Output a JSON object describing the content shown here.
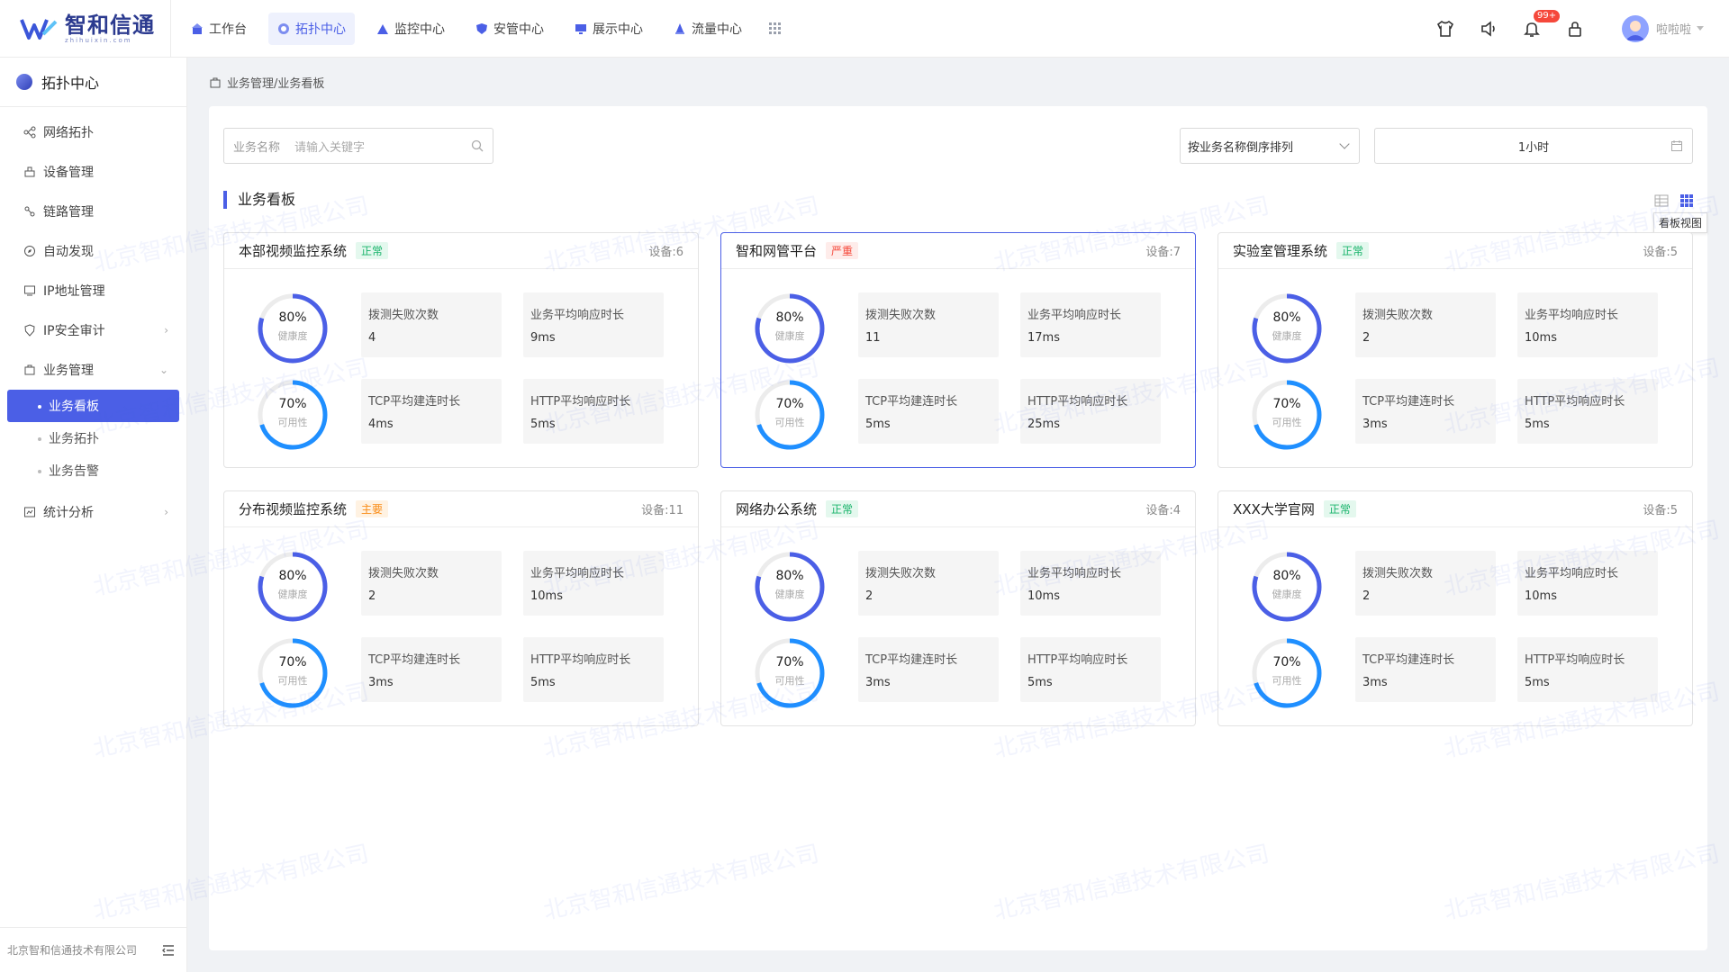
{
  "brand": {
    "title": "智和信通",
    "subtitle": "zhihuixin.com"
  },
  "nav": [
    {
      "label": "工作台",
      "icon": "home-icon",
      "active": false
    },
    {
      "label": "拓扑中心",
      "icon": "topology-icon",
      "active": true
    },
    {
      "label": "监控中心",
      "icon": "monitor-icon",
      "active": false
    },
    {
      "label": "安管中心",
      "icon": "shield-icon",
      "active": false
    },
    {
      "label": "展示中心",
      "icon": "display-icon",
      "active": false
    },
    {
      "label": "流量中心",
      "icon": "traffic-icon",
      "active": false
    }
  ],
  "header": {
    "badge": "99+",
    "username": "啦啦啦"
  },
  "sidebar": {
    "title": "拓扑中心",
    "items": [
      {
        "label": "网络拓扑",
        "icon": "network-icon"
      },
      {
        "label": "设备管理",
        "icon": "device-icon"
      },
      {
        "label": "链路管理",
        "icon": "link-icon"
      },
      {
        "label": "自动发现",
        "icon": "discover-icon"
      },
      {
        "label": "IP地址管理",
        "icon": "ip-icon"
      },
      {
        "label": "IP安全审计",
        "icon": "audit-icon"
      },
      {
        "label": "业务管理",
        "icon": "business-icon"
      }
    ],
    "sub_items": [
      {
        "label": "业务看板",
        "active": true
      },
      {
        "label": "业务拓扑",
        "active": false
      },
      {
        "label": "业务告警",
        "active": false
      }
    ],
    "extra": {
      "label": "统计分析",
      "icon": "stats-icon"
    },
    "footer": "北京智和信通技术有限公司"
  },
  "breadcrumb": "业务管理/业务看板",
  "filters": {
    "search_label": "业务名称",
    "search_placeholder": "请输入关键字",
    "sort_value": "按业务名称倒序排列",
    "time_value": "1小时"
  },
  "section_title": "业务看板",
  "view_tooltip": "看板视图",
  "watermark": "北京智和信通技术有限公司",
  "colors": {
    "accent": "#4b5fe6",
    "gauge_health": "#4b5fe6",
    "gauge_avail": "#1f8fff"
  },
  "cards": [
    {
      "name": "本部视频监控系统",
      "status": "正常",
      "status_type": "normal",
      "device": "设备:6",
      "selected": false,
      "health": 0.8,
      "health_text": "80%",
      "health_label": "健康度",
      "avail": 0.7,
      "avail_text": "70%",
      "avail_label": "可用性",
      "metrics": [
        {
          "label": "拨测失败次数",
          "value": "4"
        },
        {
          "label": "业务平均响应时长",
          "value": "9ms"
        },
        {
          "label": "TCP平均建连时长",
          "value": "4ms"
        },
        {
          "label": "HTTP平均响应时长",
          "value": "5ms"
        }
      ]
    },
    {
      "name": "智和网管平台",
      "status": "严重",
      "status_type": "severe",
      "device": "设备:7",
      "selected": true,
      "health": 0.8,
      "health_text": "80%",
      "health_label": "健康度",
      "avail": 0.7,
      "avail_text": "70%",
      "avail_label": "可用性",
      "metrics": [
        {
          "label": "拨测失败次数",
          "value": "11"
        },
        {
          "label": "业务平均响应时长",
          "value": "17ms"
        },
        {
          "label": "TCP平均建连时长",
          "value": "5ms"
        },
        {
          "label": "HTTP平均响应时长",
          "value": "25ms"
        }
      ]
    },
    {
      "name": "实验室管理系统",
      "status": "正常",
      "status_type": "normal",
      "device": "设备:5",
      "selected": false,
      "health": 0.8,
      "health_text": "80%",
      "health_label": "健康度",
      "avail": 0.7,
      "avail_text": "70%",
      "avail_label": "可用性",
      "metrics": [
        {
          "label": "拨测失败次数",
          "value": "2"
        },
        {
          "label": "业务平均响应时长",
          "value": "10ms"
        },
        {
          "label": "TCP平均建连时长",
          "value": "3ms"
        },
        {
          "label": "HTTP平均响应时长",
          "value": "5ms"
        }
      ]
    },
    {
      "name": "分布视频监控系统",
      "status": "主要",
      "status_type": "major",
      "device": "设备:11",
      "selected": false,
      "health": 0.8,
      "health_text": "80%",
      "health_label": "健康度",
      "avail": 0.7,
      "avail_text": "70%",
      "avail_label": "可用性",
      "metrics": [
        {
          "label": "拨测失败次数",
          "value": "2"
        },
        {
          "label": "业务平均响应时长",
          "value": "10ms"
        },
        {
          "label": "TCP平均建连时长",
          "value": "3ms"
        },
        {
          "label": "HTTP平均响应时长",
          "value": "5ms"
        }
      ]
    },
    {
      "name": "网络办公系统",
      "status": "正常",
      "status_type": "normal",
      "device": "设备:4",
      "selected": false,
      "health": 0.8,
      "health_text": "80%",
      "health_label": "健康度",
      "avail": 0.7,
      "avail_text": "70%",
      "avail_label": "可用性",
      "metrics": [
        {
          "label": "拨测失败次数",
          "value": "2"
        },
        {
          "label": "业务平均响应时长",
          "value": "10ms"
        },
        {
          "label": "TCP平均建连时长",
          "value": "3ms"
        },
        {
          "label": "HTTP平均响应时长",
          "value": "5ms"
        }
      ]
    },
    {
      "name": "XXX大学官网",
      "status": "正常",
      "status_type": "normal",
      "device": "设备:5",
      "selected": false,
      "health": 0.8,
      "health_text": "80%",
      "health_label": "健康度",
      "avail": 0.7,
      "avail_text": "70%",
      "avail_label": "可用性",
      "metrics": [
        {
          "label": "拨测失败次数",
          "value": "2"
        },
        {
          "label": "业务平均响应时长",
          "value": "10ms"
        },
        {
          "label": "TCP平均建连时长",
          "value": "3ms"
        },
        {
          "label": "HTTP平均响应时长",
          "value": "5ms"
        }
      ]
    }
  ]
}
